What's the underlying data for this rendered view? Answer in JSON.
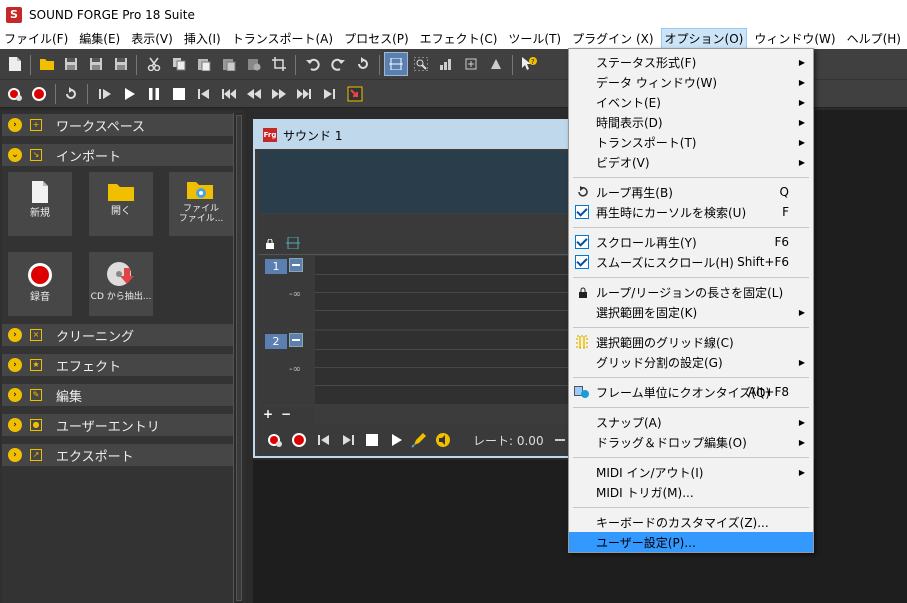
{
  "app": {
    "title": "SOUND FORGE Pro 18 Suite",
    "logo_letter": "S"
  },
  "menubar": [
    {
      "label": "ファイル(F)"
    },
    {
      "label": "編集(E)"
    },
    {
      "label": "表示(V)"
    },
    {
      "label": "挿入(I)"
    },
    {
      "label": "トランスポート(A)"
    },
    {
      "label": "プロセス(P)"
    },
    {
      "label": "エフェクト(C)"
    },
    {
      "label": "ツール(T)"
    },
    {
      "label": "プラグイン (X)"
    },
    {
      "label": "オプション(O)"
    },
    {
      "label": "ウィンドウ(W)"
    },
    {
      "label": "ヘルプ(H)"
    }
  ],
  "left_panel": {
    "sections": [
      {
        "label": "ワークスペース"
      },
      {
        "label": "インポート"
      },
      {
        "label": "クリーニング"
      },
      {
        "label": "エフェクト"
      },
      {
        "label": "編集"
      },
      {
        "label": "ユーザーエントリ"
      },
      {
        "label": "エクスポート"
      }
    ],
    "tiles": [
      {
        "label": "新規"
      },
      {
        "label": "開く"
      },
      {
        "label": "ファイル\nファイル..."
      },
      {
        "label": "録音"
      },
      {
        "label": "CD から抽出..."
      }
    ]
  },
  "document": {
    "title": "サウンド 1",
    "logo_text": "Frg",
    "channels": [
      {
        "number": "1",
        "level": "-∞"
      },
      {
        "number": "2",
        "level": "-∞"
      }
    ],
    "plus": "+",
    "minus": "−",
    "rate_label": "レート: 0.00"
  },
  "options_menu": {
    "items": [
      {
        "label": "ステータス形式(F)",
        "submenu": true
      },
      {
        "label": "データ ウィンドウ(W)",
        "submenu": true
      },
      {
        "label": "イベント(E)",
        "submenu": true
      },
      {
        "label": "時間表示(D)",
        "submenu": true
      },
      {
        "label": "トランスポート(T)",
        "submenu": true
      },
      {
        "label": "ビデオ(V)",
        "submenu": true
      },
      {
        "label": "ループ再生(B)",
        "shortcut": "Q",
        "icon": "loop-icon"
      },
      {
        "label": "再生時にカーソルを検索(U)",
        "shortcut": "F",
        "checked": true
      },
      {
        "label": "スクロール再生(Y)",
        "shortcut": "F6",
        "checked": true
      },
      {
        "label": "スムーズにスクロール(H)",
        "shortcut": "Shift+F6",
        "checked": true
      },
      {
        "label": "ループ/リージョンの長さを固定(L)",
        "icon": "lock-icon"
      },
      {
        "label": "選択範囲を固定(K)",
        "submenu": true
      },
      {
        "label": "選択範囲のグリッド線(C)",
        "icon": "grid-lines-icon"
      },
      {
        "label": "グリッド分割の設定(G)",
        "submenu": true
      },
      {
        "label": "フレーム単位にクオンタイズ(Q)",
        "shortcut": "Alt+F8",
        "icon": "quantize-icon"
      },
      {
        "label": "スナップ(A)",
        "submenu": true
      },
      {
        "label": "ドラッグ＆ドロップ編集(O)",
        "submenu": true
      },
      {
        "label": "MIDI イン/アウト(I)",
        "submenu": true
      },
      {
        "label": "MIDI トリガ(M)..."
      },
      {
        "label": "キーボードのカスタマイズ(Z)..."
      },
      {
        "label": "ユーザー設定(P)...",
        "highlighted": true
      }
    ]
  }
}
